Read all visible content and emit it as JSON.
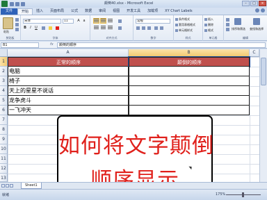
{
  "window": {
    "title": "颠倒40.xlsx - Microsoft Excel"
  },
  "tabs": [
    {
      "label": "文件"
    },
    {
      "label": "开始"
    },
    {
      "label": "插入"
    },
    {
      "label": "页面布局"
    },
    {
      "label": "公式"
    },
    {
      "label": "数据"
    },
    {
      "label": "审阅"
    },
    {
      "label": "视图"
    },
    {
      "label": "开发工具"
    },
    {
      "label": "加载项"
    },
    {
      "label": "XY Chart Labels"
    }
  ],
  "ribbon": {
    "paste_label": "粘贴",
    "font_name": "宋体",
    "font_size": "11",
    "number_format": "常规",
    "groups": [
      "剪贴板",
      "字体",
      "对齐方式",
      "数字",
      "样式",
      "单元格",
      "编辑"
    ],
    "styles": [
      "条件格式",
      "套用表格格式",
      "单元格样式"
    ],
    "cells": [
      "插入",
      "删除",
      "格式"
    ],
    "editing": [
      "排序和筛选",
      "查找和选择"
    ]
  },
  "formula_bar": {
    "name_box": "B1",
    "fx": "fx",
    "content": "颠倒的顺序"
  },
  "columns": [
    "A",
    "B",
    "C"
  ],
  "rows": [
    "1",
    "2",
    "3",
    "4",
    "5",
    "6",
    "7",
    "8",
    "9",
    "10",
    "11",
    "12",
    "13"
  ],
  "table": {
    "header": [
      "正常的顺序",
      "颠倒的顺序"
    ],
    "rows": [
      [
        "电脑",
        ""
      ],
      [
        "椅子",
        ""
      ],
      [
        "天上的星星不说话",
        ""
      ],
      [
        "龙争虎斗",
        ""
      ],
      [
        "一飞冲天",
        ""
      ]
    ]
  },
  "overlay": {
    "line1": "如何将文字颠倒",
    "line2": "顺序显示"
  },
  "sheet_tab": "Sheet1",
  "status": {
    "ready": "就绪",
    "zoom": "175%"
  }
}
